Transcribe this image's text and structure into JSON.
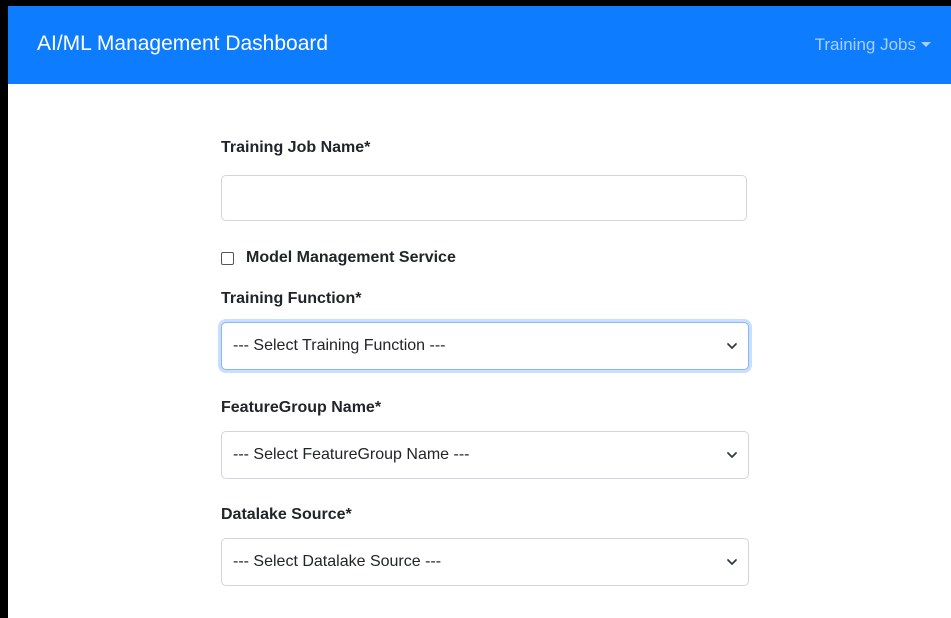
{
  "header": {
    "brand": "AI/ML Management Dashboard",
    "nav_dropdown": "Training Jobs"
  },
  "form": {
    "job_name": {
      "label": "Training Job Name*",
      "value": "",
      "placeholder": ""
    },
    "model_management": {
      "label": "Model Management Service",
      "checked": false
    },
    "training_function": {
      "label": "Training Function*",
      "selected": "--- Select Training Function ---"
    },
    "feature_group": {
      "label": "FeatureGroup Name*",
      "selected": "--- Select FeatureGroup Name ---"
    },
    "datalake_source": {
      "label": "Datalake Source*",
      "selected": "--- Select Datalake Source ---"
    }
  },
  "colors": {
    "navbar": "#0d7cff",
    "brand_text": "#ffffff",
    "nav_link": "#a9cffc",
    "focus_ring": "#86b7fe"
  },
  "icons": {
    "dropdown_caret": "caret-down-icon",
    "select_chevron": "chevron-down-icon"
  }
}
